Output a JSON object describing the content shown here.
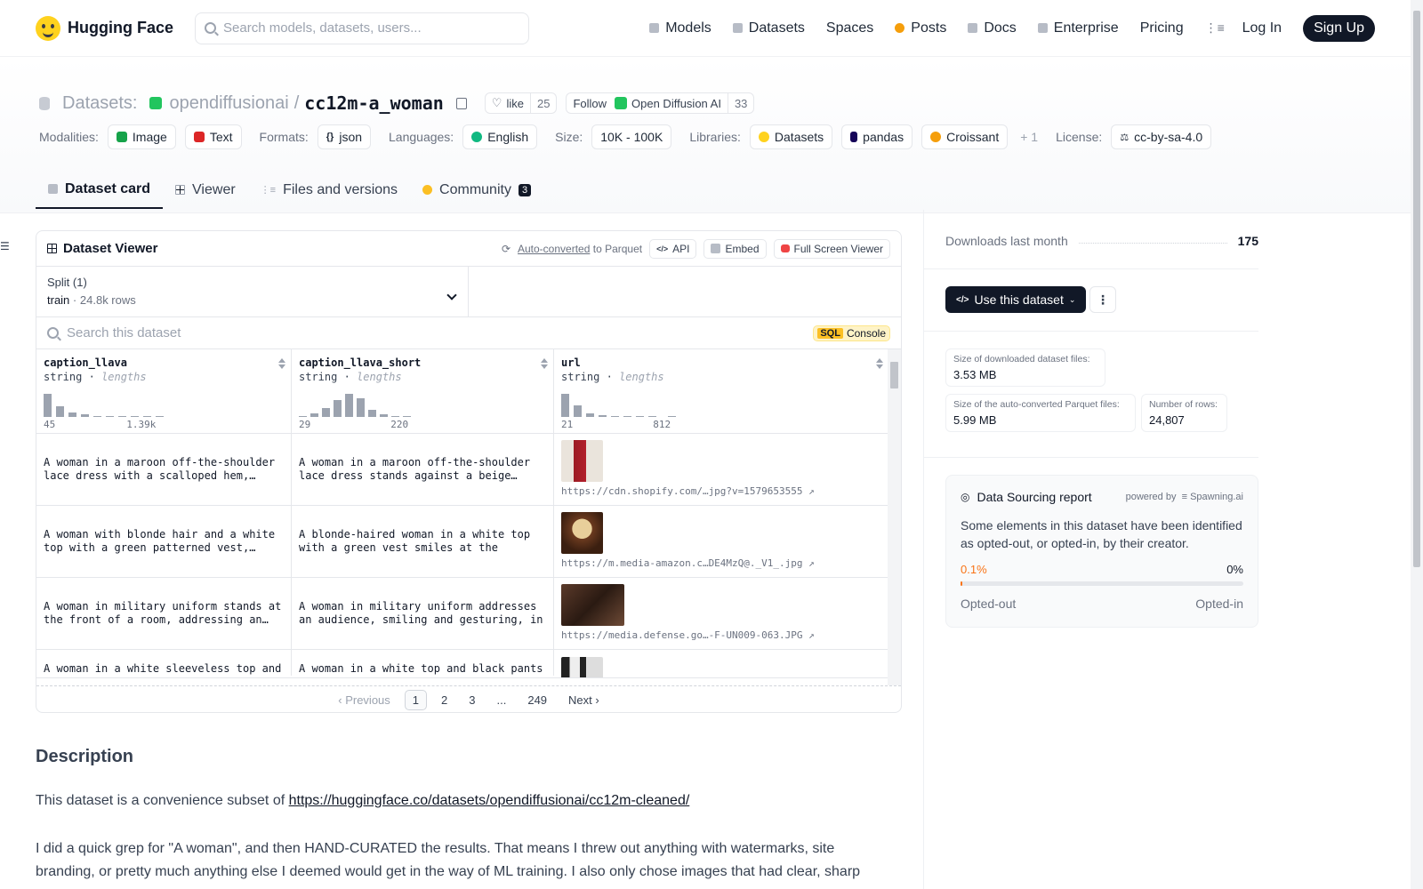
{
  "header": {
    "brand": "Hugging Face",
    "search_placeholder": "Search models, datasets, users...",
    "nav": [
      "Models",
      "Datasets",
      "Spaces",
      "Posts",
      "Docs",
      "Enterprise",
      "Pricing"
    ],
    "login": "Log In",
    "signup": "Sign Up"
  },
  "repo": {
    "section": "Datasets:",
    "org": "opendiffusionai",
    "sep": "/",
    "name": "cc12m-a_woman",
    "like_label": "like",
    "like_count": "25",
    "follow_label": "Follow",
    "follow_org": "Open Diffusion AI",
    "follow_count": "33"
  },
  "meta": {
    "modalities_label": "Modalities:",
    "modalities": [
      "Image",
      "Text"
    ],
    "formats_label": "Formats:",
    "format": "json",
    "languages_label": "Languages:",
    "language": "English",
    "size_label": "Size:",
    "size": "10K - 100K",
    "libraries_label": "Libraries:",
    "libraries": [
      "Datasets",
      "pandas",
      "Croissant"
    ],
    "libraries_more": "+ 1",
    "license_label": "License:",
    "license": "cc-by-sa-4.0"
  },
  "tabs": {
    "card": "Dataset card",
    "viewer": "Viewer",
    "files": "Files and versions",
    "community": "Community",
    "community_count": "3"
  },
  "viewer": {
    "title": "Dataset Viewer",
    "auto": "Auto-converted",
    "to_parquet": "to Parquet",
    "api": "API",
    "embed": "Embed",
    "fullscreen": "Full Screen Viewer",
    "split_label": "Split (1)",
    "split_name": "train",
    "split_dot": "·",
    "split_rows": "24.8k rows",
    "search_placeholder": "Search this dataset",
    "sql": "SQL",
    "console": "Console",
    "columns": [
      {
        "name": "caption_llava",
        "type": "string",
        "sep": "·",
        "sub": "lengths",
        "min": "45",
        "max": "1.39k"
      },
      {
        "name": "caption_llava_short",
        "type": "string",
        "sep": "·",
        "sub": "lengths",
        "min": "29",
        "max": "220"
      },
      {
        "name": "url",
        "type": "string",
        "sep": "·",
        "sub": "lengths",
        "min": "21",
        "max": "812"
      }
    ],
    "rows": [
      {
        "c1": "A woman in a maroon off-the-shoulder lace dress with a scalloped hem,…",
        "c2": "A woman in a maroon off-the-shoulder lace dress stands against a beige…",
        "url": "https://cdn.shopify.com/…jpg?v=1579653555 ↗"
      },
      {
        "c1": "A woman with blonde hair and a white top with a green patterned vest,…",
        "c2": "A blonde-haired woman in a white top with a green vest smiles at the camera,…",
        "url": "https://m.media-amazon.c…DE4MzQ@._V1_.jpg ↗"
      },
      {
        "c1": "A woman in military uniform stands at the front of a room, addressing an…",
        "c2": "A woman in military uniform addresses an audience, smiling and gesturing, in a…",
        "url": "https://media.defense.go…-F-UN009-063.JPG ↗"
      },
      {
        "c1": "A woman in a white sleeveless top and",
        "c2": "A woman in a white top and black pants",
        "url": ""
      }
    ],
    "pager": {
      "prev": "‹ Previous",
      "pages": [
        "1",
        "2",
        "3",
        "...",
        "249"
      ],
      "next": "Next ›"
    }
  },
  "description": {
    "heading": "Description",
    "p1_text": "This dataset is a convenience subset of ",
    "p1_link": "https://huggingface.co/datasets/opendiffusionai/cc12m-cleaned/",
    "p2": "I did a quick grep for \"A woman\", and then HAND-CURATED the results. That means I threw out anything with watermarks, site branding, or pretty much anything else I deemed would get in the way of ML training. I also only chose images that had clear, sharp"
  },
  "sidebar": {
    "downloads_label": "Downloads last month",
    "downloads": "175",
    "use_btn": "Use this dataset",
    "stats": [
      {
        "k": "Size of downloaded dataset files:",
        "v": "3.53 MB"
      },
      {
        "k": "Size of the auto-converted Parquet files:",
        "v": "5.99 MB"
      },
      {
        "k": "Number of rows:",
        "v": "24,807"
      }
    ],
    "dsr_title": "Data Sourcing report",
    "powered_by": "powered by",
    "spawning": "Spawning.ai",
    "dsr_text": "Some elements in this dataset have been identified as opted-out, or opted-in, by their creator.",
    "opted_out_pct": "0.1%",
    "opted_in_pct": "0%",
    "opted_out_fraction": 0.006,
    "opted_out": "Opted-out",
    "opted_in": "Opted-in"
  },
  "colors": {
    "accent_orange": "#f97316",
    "dark": "#111827",
    "hf_yellow": "#ffd21e"
  }
}
